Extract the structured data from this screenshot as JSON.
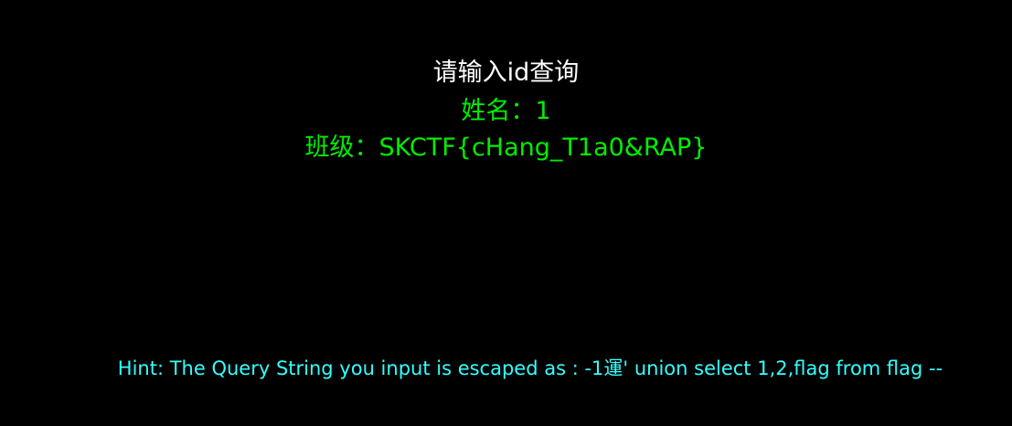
{
  "colors": {
    "background": "#000000",
    "prompt": "#ffffff",
    "result": "#00ee00",
    "hint": "#33ffff"
  },
  "query": {
    "prompt": "请输入id查询"
  },
  "result": {
    "name_line": "姓名：1",
    "class_line": "班级：SKCTF{cHang_T1a0&RAP}"
  },
  "hint": {
    "text": "Hint: The Query String you input is escaped as : -1運' union select 1,2,flag from flag --"
  }
}
